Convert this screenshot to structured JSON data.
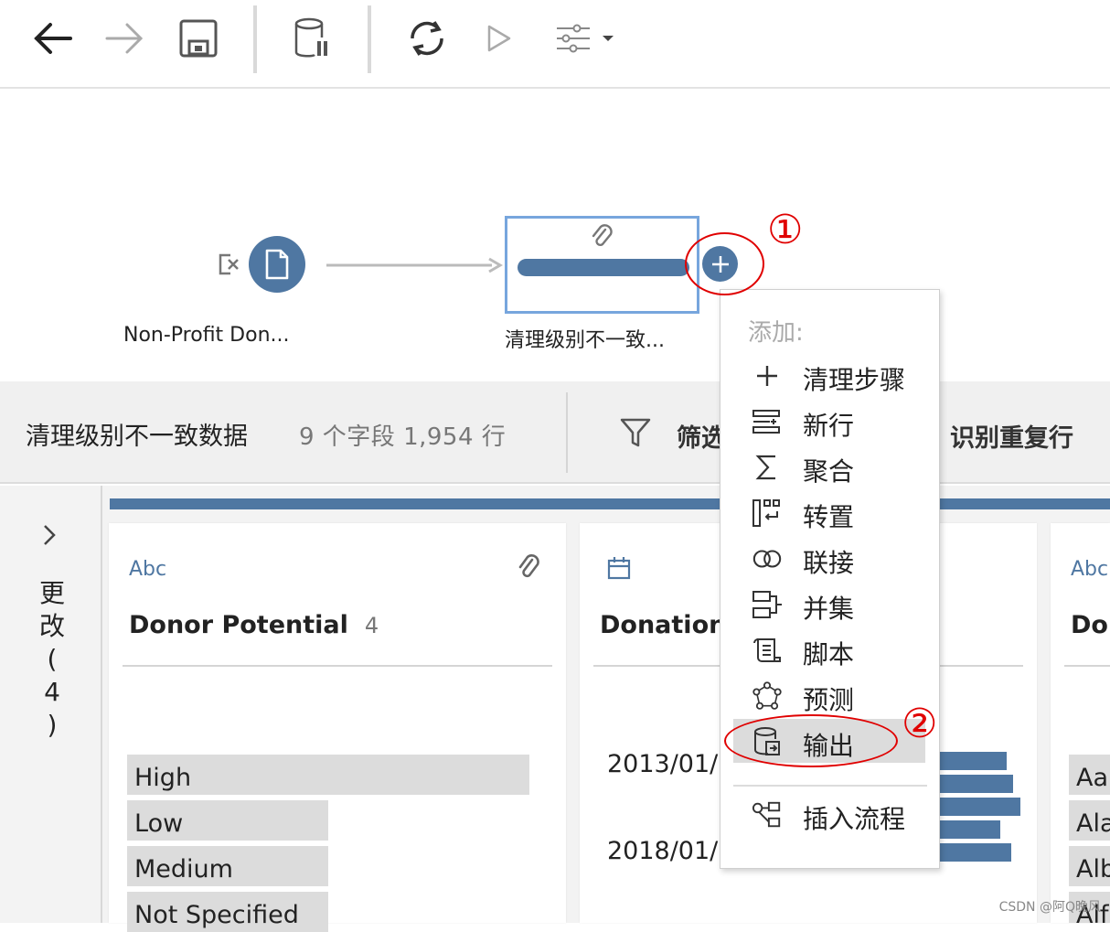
{
  "toolbar": {
    "buttons": [
      "back-icon",
      "forward-icon",
      "save-icon",
      "pause-data-icon",
      "refresh-icon",
      "run-icon",
      "settings-icon"
    ]
  },
  "flow": {
    "input_node_label": "Non-Profit Don...",
    "clean_node_label": "清理级别不一致..."
  },
  "step_header": {
    "name": "清理级别不一致数据",
    "meta": "9 个字段  1,954 行",
    "filter_label": "筛选",
    "dedupe_label": "识别重复行"
  },
  "changes_panel": {
    "label": "更改(4)"
  },
  "profile": {
    "cards": [
      {
        "type": "Abc",
        "title": "Donor Potential",
        "count": "4",
        "values": [
          {
            "label": "High",
            "fraction": 1.0
          },
          {
            "label": "Low",
            "fraction": 0.5
          },
          {
            "label": "Medium",
            "fraction": 0.5
          },
          {
            "label": "Not Specified",
            "fraction": 0.5
          }
        ]
      },
      {
        "type": "calendar-icon",
        "title": "Donation",
        "ticks": [
          "2013/01/",
          "2018/01/"
        ]
      },
      {
        "type": "Abc",
        "title": "Do",
        "values": [
          "Aa",
          "Ala",
          "Alb",
          "Alf"
        ]
      }
    ]
  },
  "menu": {
    "title": "添加:",
    "items": [
      {
        "icon": "plus-icon",
        "label": "清理步骤"
      },
      {
        "icon": "new-rows-icon",
        "label": "新行"
      },
      {
        "icon": "sigma-icon",
        "label": "聚合"
      },
      {
        "icon": "pivot-icon",
        "label": "转置"
      },
      {
        "icon": "join-icon",
        "label": "联接"
      },
      {
        "icon": "union-icon",
        "label": "并集"
      },
      {
        "icon": "script-icon",
        "label": "脚本"
      },
      {
        "icon": "predict-icon",
        "label": "预测"
      },
      {
        "icon": "output-icon",
        "label": "输出"
      },
      {
        "icon": "insert-flow-icon",
        "label": "插入流程"
      }
    ],
    "highlighted": "输出"
  },
  "annotations": {
    "one": "①",
    "two": "②"
  },
  "watermark": "CSDN @阿Q晚风",
  "colors": {
    "accent": "#4f77a2",
    "annotation": "#e00000"
  }
}
